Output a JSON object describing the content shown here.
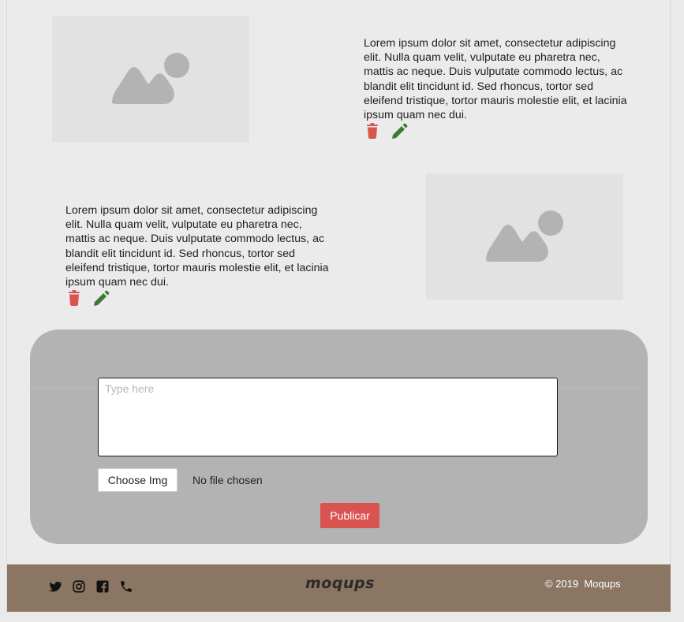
{
  "posts": [
    {
      "image_icon": "image-placeholder-icon",
      "text": "Lorem ipsum dolor sit amet, consectetur adipiscing elit. Nulla quam velit, vulputate eu pharetra nec, mattis ac neque. Duis vulputate commodo lectus, ac blandit elit tincidunt id. Sed rhoncus, tortor sed eleifend tristique, tortor mauris molestie elit, et lacinia ipsum quam nec dui.",
      "delete_icon": "trash-icon",
      "edit_icon": "pencil-icon"
    },
    {
      "image_icon": "image-placeholder-icon",
      "text": "Lorem ipsum dolor sit amet, consectetur adipiscing elit. Nulla quam velit, vulputate eu pharetra nec, mattis ac neque. Duis vulputate commodo lectus, ac blandit elit tincidunt id. Sed rhoncus, tortor sed eleifend tristique, tortor mauris molestie elit, et lacinia ipsum quam nec dui.",
      "delete_icon": "trash-icon",
      "edit_icon": "pencil-icon"
    }
  ],
  "composer": {
    "placeholder": "Type here",
    "choose_label": "Choose Img",
    "file_status": "No file chosen",
    "publish_label": "Publicar"
  },
  "footer": {
    "social_icons": [
      "twitter-icon",
      "instagram-icon",
      "facebook-icon",
      "phone-icon"
    ],
    "brand": "moqups",
    "copyright": "© 2019  Moqups"
  },
  "colors": {
    "background": "#ebebeb",
    "image_placeholder": "#e2e2e2",
    "image_icon": "#b3b3b3",
    "delete": "#d9534f",
    "edit": "#3f7a35",
    "composer_bg": "#b3b3b3",
    "publish": "#d9534f",
    "footer_bg": "#8a7663"
  }
}
